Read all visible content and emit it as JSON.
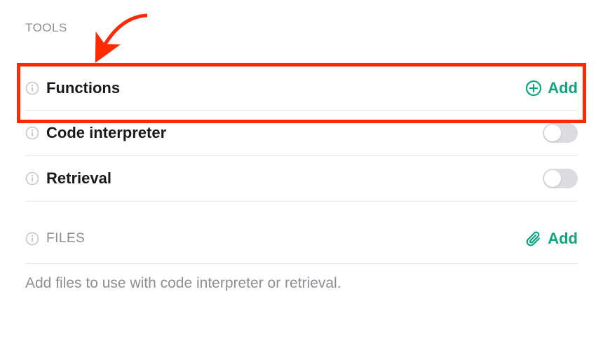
{
  "tools": {
    "header": "TOOLS",
    "items": [
      {
        "label": "Functions",
        "action_label": "Add"
      },
      {
        "label": "Code interpreter"
      },
      {
        "label": "Retrieval"
      }
    ]
  },
  "files": {
    "header": "FILES",
    "action_label": "Add",
    "description": "Add files to use with code interpreter or retrieval."
  },
  "colors": {
    "accent": "#10a37f",
    "highlight": "#ff2a00"
  }
}
